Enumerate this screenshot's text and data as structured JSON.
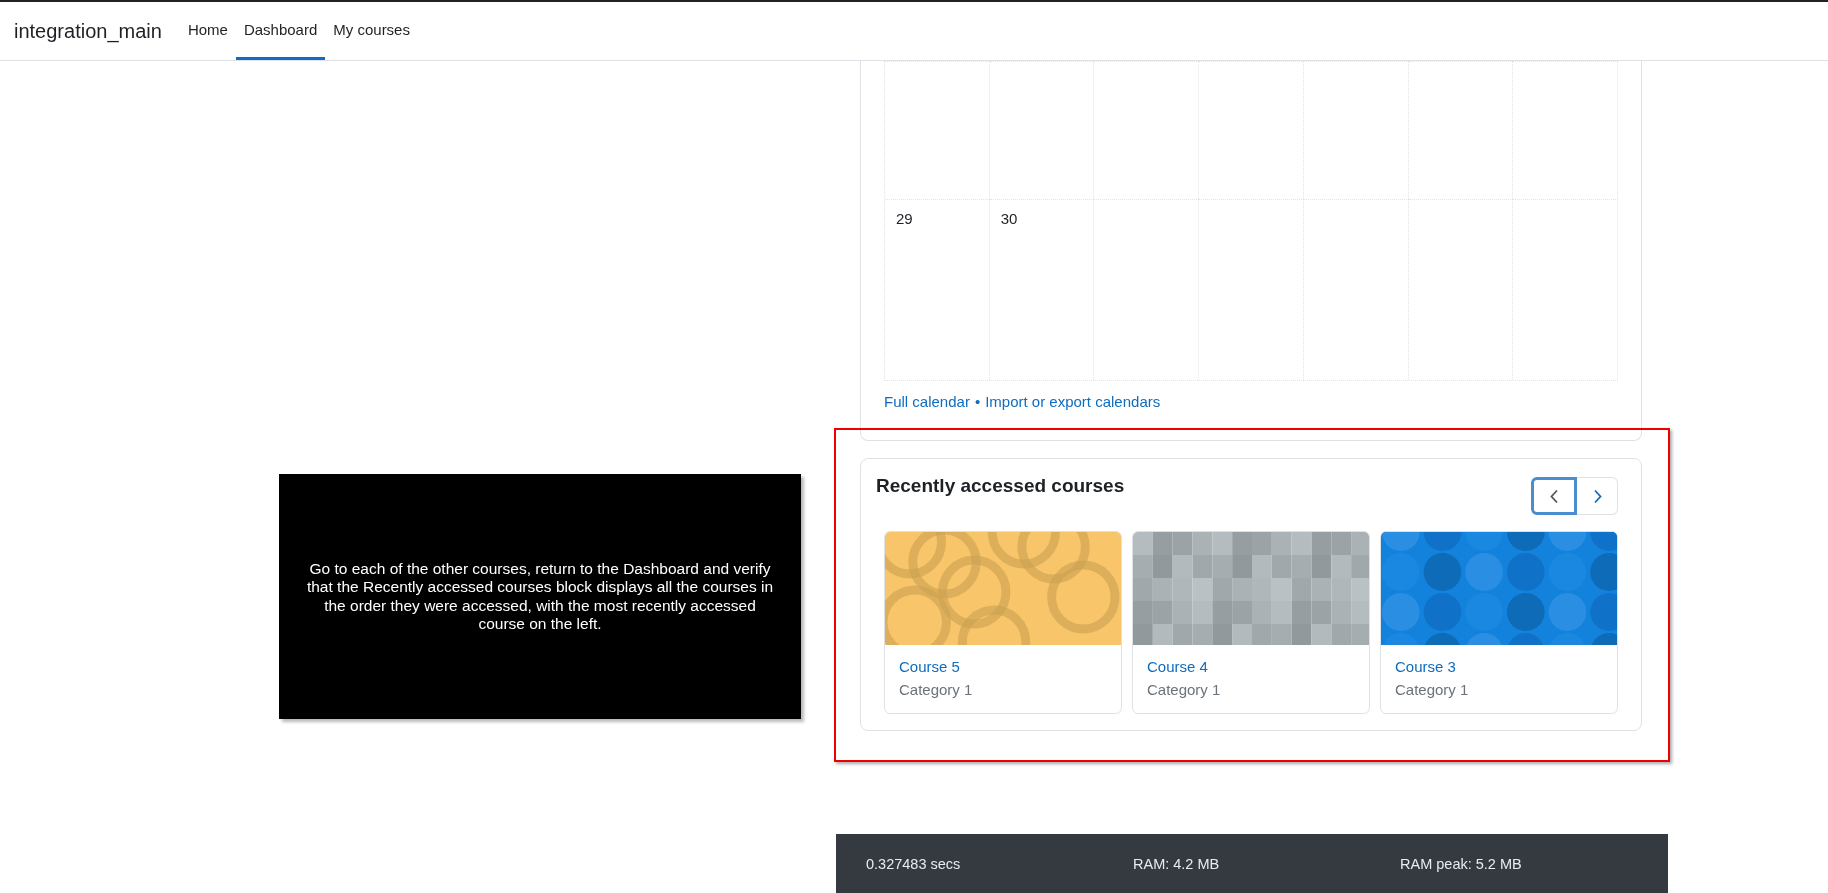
{
  "navbar": {
    "brand": "integration_main",
    "items": [
      {
        "label": "Home",
        "selected": false
      },
      {
        "label": "Dashboard",
        "selected": true
      },
      {
        "label": "My courses",
        "selected": false
      }
    ]
  },
  "instruction": {
    "text": "Go to each of the other courses, return to the Dashboard and verify that the Recently accessed courses block displays all the courses in the order they were accessed, with the most recently accessed course on the left."
  },
  "calendar": {
    "last_week_days": [
      "29",
      "30"
    ],
    "links": [
      "Full calendar",
      "Import or export calendars"
    ],
    "separator": "•"
  },
  "recent_courses": {
    "title": "Recently accessed courses",
    "prev_focused": true,
    "courses": [
      {
        "name": "Course 5",
        "category": "Category 1"
      },
      {
        "name": "Course 4",
        "category": "Category 1"
      },
      {
        "name": "Course 3",
        "category": "Category 1"
      }
    ]
  },
  "footer": {
    "items": [
      "0.327483 secs",
      "RAM: 4.2 MB",
      "RAM peak: 5.2 MB"
    ]
  }
}
